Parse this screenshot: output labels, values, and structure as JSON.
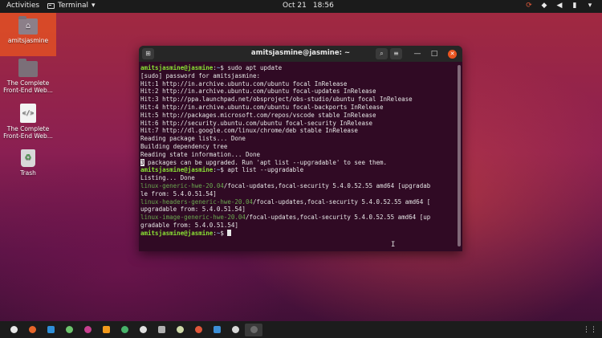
{
  "topbar": {
    "activities": "Activities",
    "app_name": "Terminal",
    "app_caret": "▾",
    "date": "Oct 21",
    "time": "18:56",
    "tray": [
      {
        "name": "update-icon",
        "glyph": "⟳",
        "color": "#e05a3a"
      },
      {
        "name": "wifi-icon",
        "glyph": "◆"
      },
      {
        "name": "volume-icon",
        "glyph": "◀"
      },
      {
        "name": "battery-icon",
        "glyph": "▮"
      },
      {
        "name": "system-menu-caret-icon",
        "glyph": "▾"
      }
    ]
  },
  "desktop": {
    "items": [
      {
        "label": "amitsjasmine",
        "icon": "home-folder-icon"
      },
      {
        "label": "The Complete Front-End Web...",
        "icon": "folder-icon"
      },
      {
        "label": "The Complete Front-End Web...",
        "icon": "html-file-icon",
        "glyph": "</>"
      },
      {
        "label": "Trash",
        "icon": "trash-icon",
        "glyph": "♻"
      }
    ]
  },
  "terminal": {
    "title": "amitsjasmine@jasmine: ~",
    "buttons": {
      "new_tab": "⊞",
      "search": "⌕",
      "menu": "≡",
      "minimize": "—",
      "maximize": "□",
      "close": "✕"
    },
    "prompt_user": "amitsjasmine@jasmine",
    "prompt_sep": ":",
    "prompt_path": "~",
    "prompt_end": "$ ",
    "cmd1": "sudo apt update",
    "lines_a": [
      "[sudo] password for amitsjasmine:",
      "Hit:1 http://in.archive.ubuntu.com/ubuntu focal InRelease",
      "Hit:2 http://in.archive.ubuntu.com/ubuntu focal-updates InRelease",
      "Hit:3 http://ppa.launchpad.net/obsproject/obs-studio/ubuntu focal InRelease",
      "Hit:4 http://in.archive.ubuntu.com/ubuntu focal-backports InRelease",
      "Hit:5 http://packages.microsoft.com/repos/vscode stable InRelease",
      "Hit:6 http://security.ubuntu.com/ubuntu focal-security InRelease",
      "Hit:7 http://dl.google.com/linux/chrome/deb stable InRelease",
      "Reading package lists... Done",
      "Building dependency tree",
      "Reading state information... Done"
    ],
    "upgrade_count": "3",
    "upgrade_msg": " packages can be upgraded. Run 'apt list --upgradable' to see them.",
    "cmd2": "apt list --upgradable",
    "listing": "Listing... Done",
    "packages": [
      {
        "name": "linux-generic-hwe-20.04",
        "rest1": "/focal-updates,focal-security 5.4.0.52.55 amd64 [upgradab",
        "rest2": "le from: 5.4.0.51.54]"
      },
      {
        "name": "linux-headers-generic-hwe-20.04",
        "rest1": "/focal-updates,focal-security 5.4.0.52.55 amd64 [",
        "rest2": "upgradable from: 5.4.0.51.54]"
      },
      {
        "name": "linux-image-generic-hwe-20.04",
        "rest1": "/focal-updates,focal-security 5.4.0.52.55 amd64 [up",
        "rest2": "gradable from: 5.4.0.51.54]"
      }
    ],
    "ibeam": "I"
  },
  "dock": {
    "items": [
      {
        "name": "chrome-icon",
        "color": "#e8e8e8"
      },
      {
        "name": "firefox-icon",
        "color": "#e8662a"
      },
      {
        "name": "vscode-icon",
        "color": "#2f8fd8"
      },
      {
        "name": "screen-recorder-icon",
        "color": "#6dc46d"
      },
      {
        "name": "color-picker-icon",
        "color": "#c73f8f"
      },
      {
        "name": "vlc-icon",
        "color": "#f39a1c"
      },
      {
        "name": "settings-icon",
        "color": "#47b36a"
      },
      {
        "name": "text-editor-icon",
        "color": "#e0e0e0"
      },
      {
        "name": "calculator-icon",
        "color": "#b0b0b0"
      },
      {
        "name": "files-icon",
        "color": "#cfd9a8"
      },
      {
        "name": "software-center-icon",
        "color": "#e0573a"
      },
      {
        "name": "help-icon",
        "color": "#3d8fd6"
      },
      {
        "name": "clock-icon",
        "color": "#d8d8d8"
      },
      {
        "name": "terminal-icon",
        "color": "#6b6b6b",
        "active": true
      }
    ],
    "grid_glyph": "⋮⋮"
  }
}
